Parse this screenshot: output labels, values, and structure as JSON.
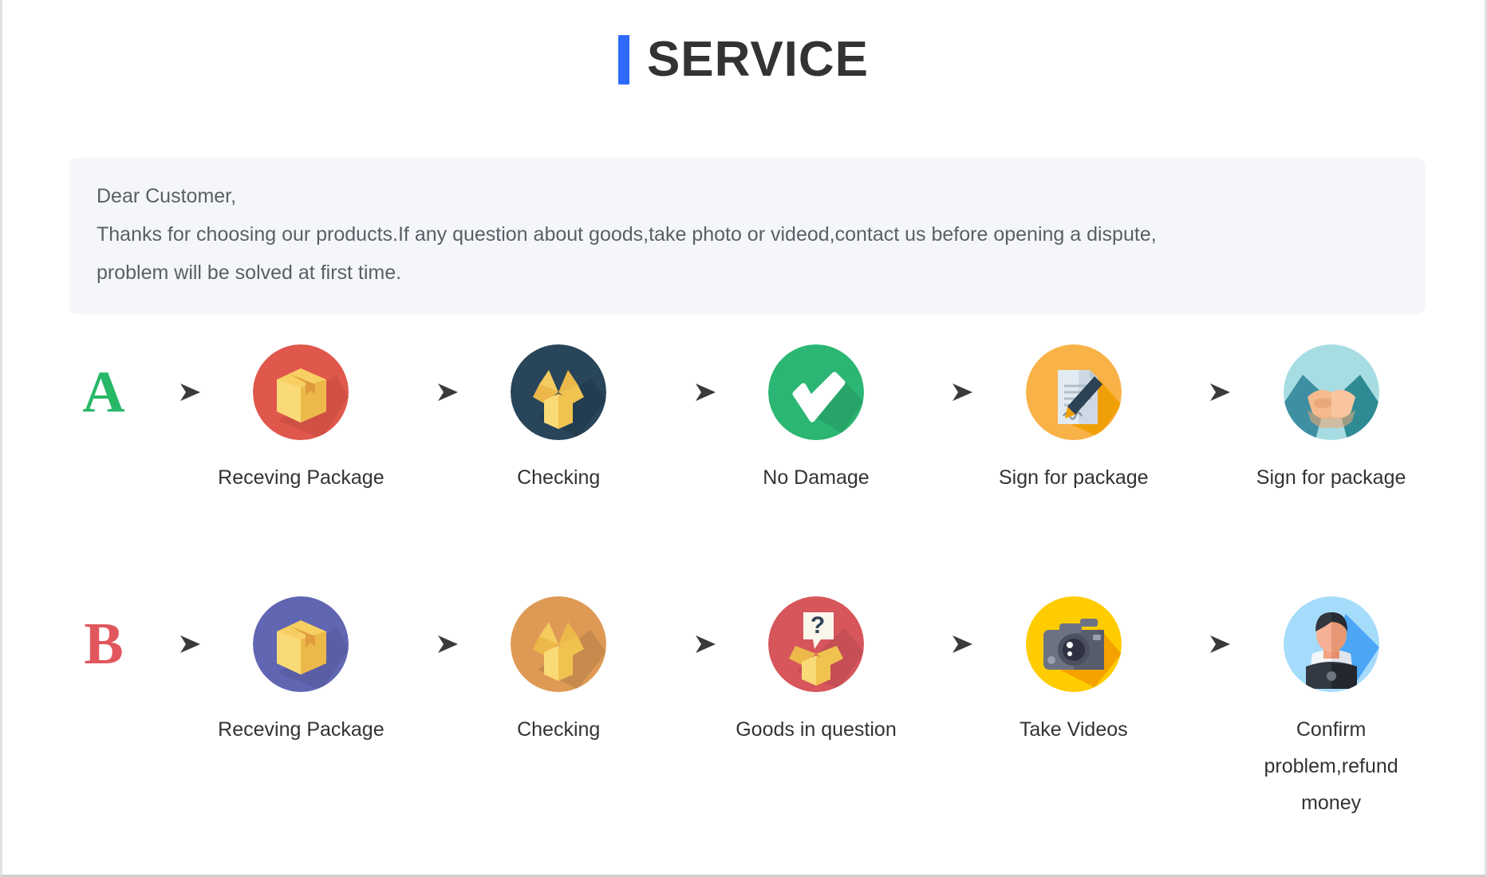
{
  "header": {
    "title": "SERVICE",
    "accent_color": "#2f6bfa"
  },
  "note": {
    "line1": "Dear Customer,",
    "line2": "Thanks for choosing our products.If any question about goods,take photo or videod,contact us before opening a dispute,",
    "line3": "problem will be solved at first time.",
    "background_color": "#f5f6fa"
  },
  "flows": [
    {
      "letter": "A",
      "letter_color": "#27b867",
      "steps": [
        {
          "icon": "closed-box-icon",
          "label": "Receving Package",
          "circle_color": "#e0574c"
        },
        {
          "icon": "open-box-icon",
          "label": "Checking",
          "circle_color": "#28455a"
        },
        {
          "icon": "checkmark-icon",
          "label": "No Damage",
          "circle_color": "#2bb673"
        },
        {
          "icon": "sign-document-icon",
          "label": "Sign for package",
          "circle_color": "#f9af3f"
        },
        {
          "icon": "handshake-icon",
          "label": "Sign for package",
          "circle_color": "#a7d9e0"
        }
      ]
    },
    {
      "letter": "B",
      "letter_color": "#e1575d",
      "steps": [
        {
          "icon": "closed-box-icon",
          "label": "Receving Package",
          "circle_color": "#6166b3"
        },
        {
          "icon": "open-box-icon",
          "label": "Checking",
          "circle_color": "#de9a55"
        },
        {
          "icon": "question-box-icon",
          "label": "Goods in question",
          "circle_color": "#d6565c"
        },
        {
          "icon": "camera-icon",
          "label": "Take Videos",
          "circle_color": "#ffcc00"
        },
        {
          "icon": "support-agent-icon",
          "label": "Confirm problem,refund money",
          "circle_color": "#a6dcfb"
        }
      ]
    }
  ],
  "arrow": {
    "name": "arrow-right-icon",
    "color": "#4a4a4a"
  }
}
